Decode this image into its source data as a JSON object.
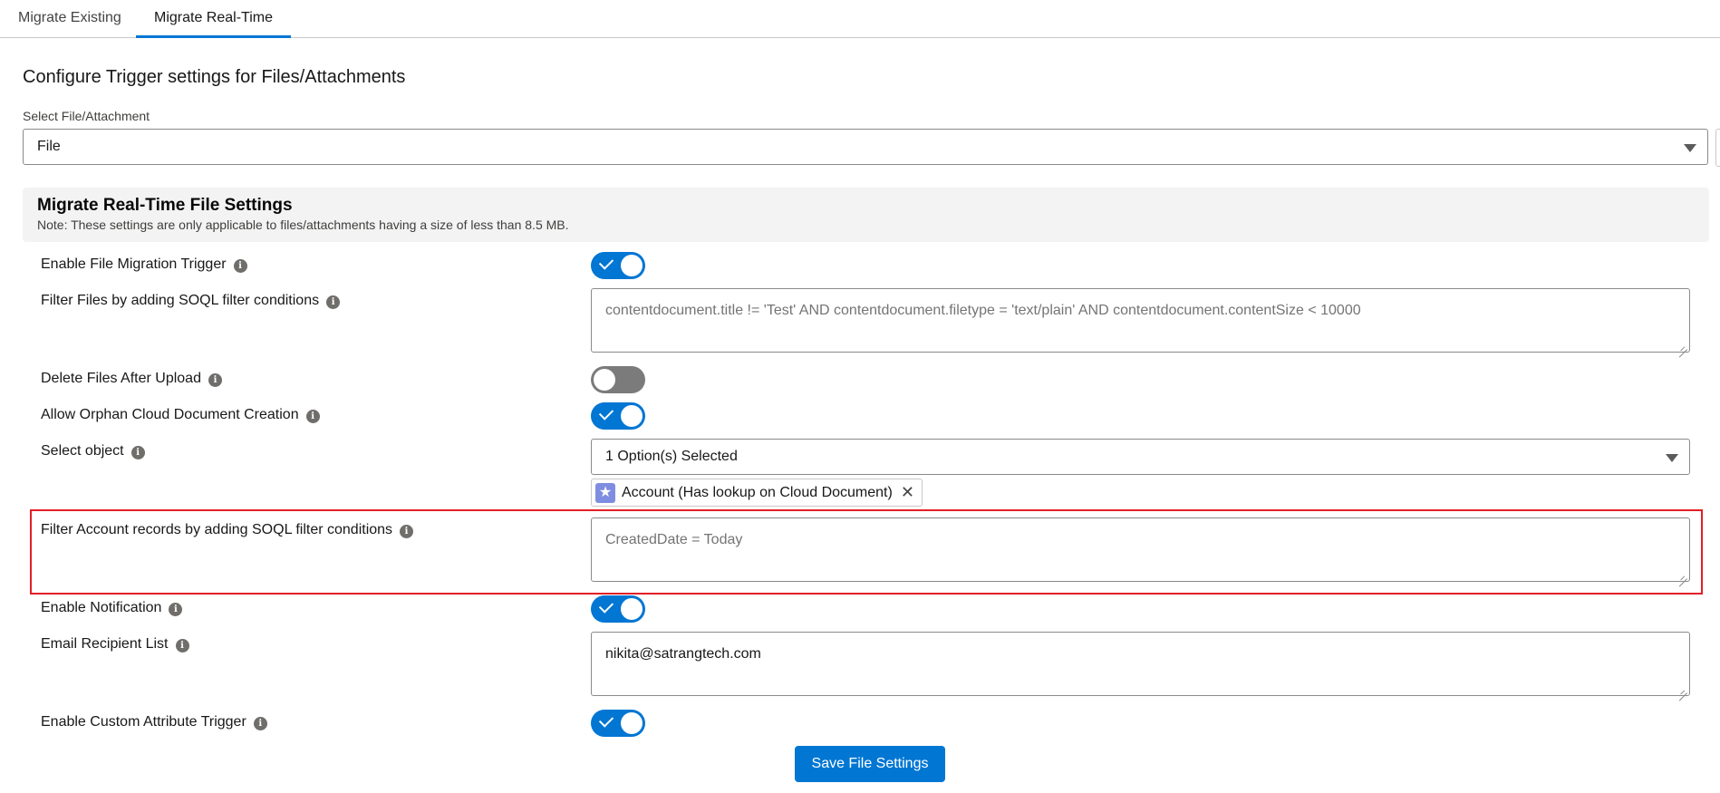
{
  "tabs": [
    {
      "label": "Migrate Existing"
    },
    {
      "label": "Migrate Real-Time"
    }
  ],
  "heading": "Configure Trigger settings for Files/Attachments",
  "file_select": {
    "label": "Select File/Attachment",
    "value": "File"
  },
  "section": {
    "title": "Migrate Real-Time File Settings",
    "note": "Note: These settings are only applicable to files/attachments having a size of less than 8.5 MB."
  },
  "settings": {
    "enable_trigger": {
      "label": "Enable File Migration Trigger",
      "on": true
    },
    "filter_files": {
      "label": "Filter Files by adding SOQL filter conditions",
      "placeholder": "contentdocument.title != 'Test' AND contentdocument.filetype = 'text/plain' AND contentdocument.contentSize < 10000"
    },
    "delete_files": {
      "label": "Delete Files After Upload",
      "on": false
    },
    "allow_orphan": {
      "label": "Allow Orphan Cloud Document Creation",
      "on": true
    },
    "select_object": {
      "label": "Select object",
      "value": "1 Option(s) Selected",
      "pill": "Account (Has lookup on Cloud Document)"
    },
    "filter_account": {
      "label": "Filter Account records by adding SOQL filter conditions",
      "placeholder": "CreatedDate = Today"
    },
    "enable_notification": {
      "label": "Enable Notification",
      "on": true
    },
    "email_list": {
      "label": "Email Recipient List",
      "value": "nikita@satrangtech.com"
    },
    "custom_attribute": {
      "label": "Enable Custom Attribute Trigger",
      "on": true
    }
  },
  "info_glyph": "i",
  "save_button": "Save File Settings"
}
